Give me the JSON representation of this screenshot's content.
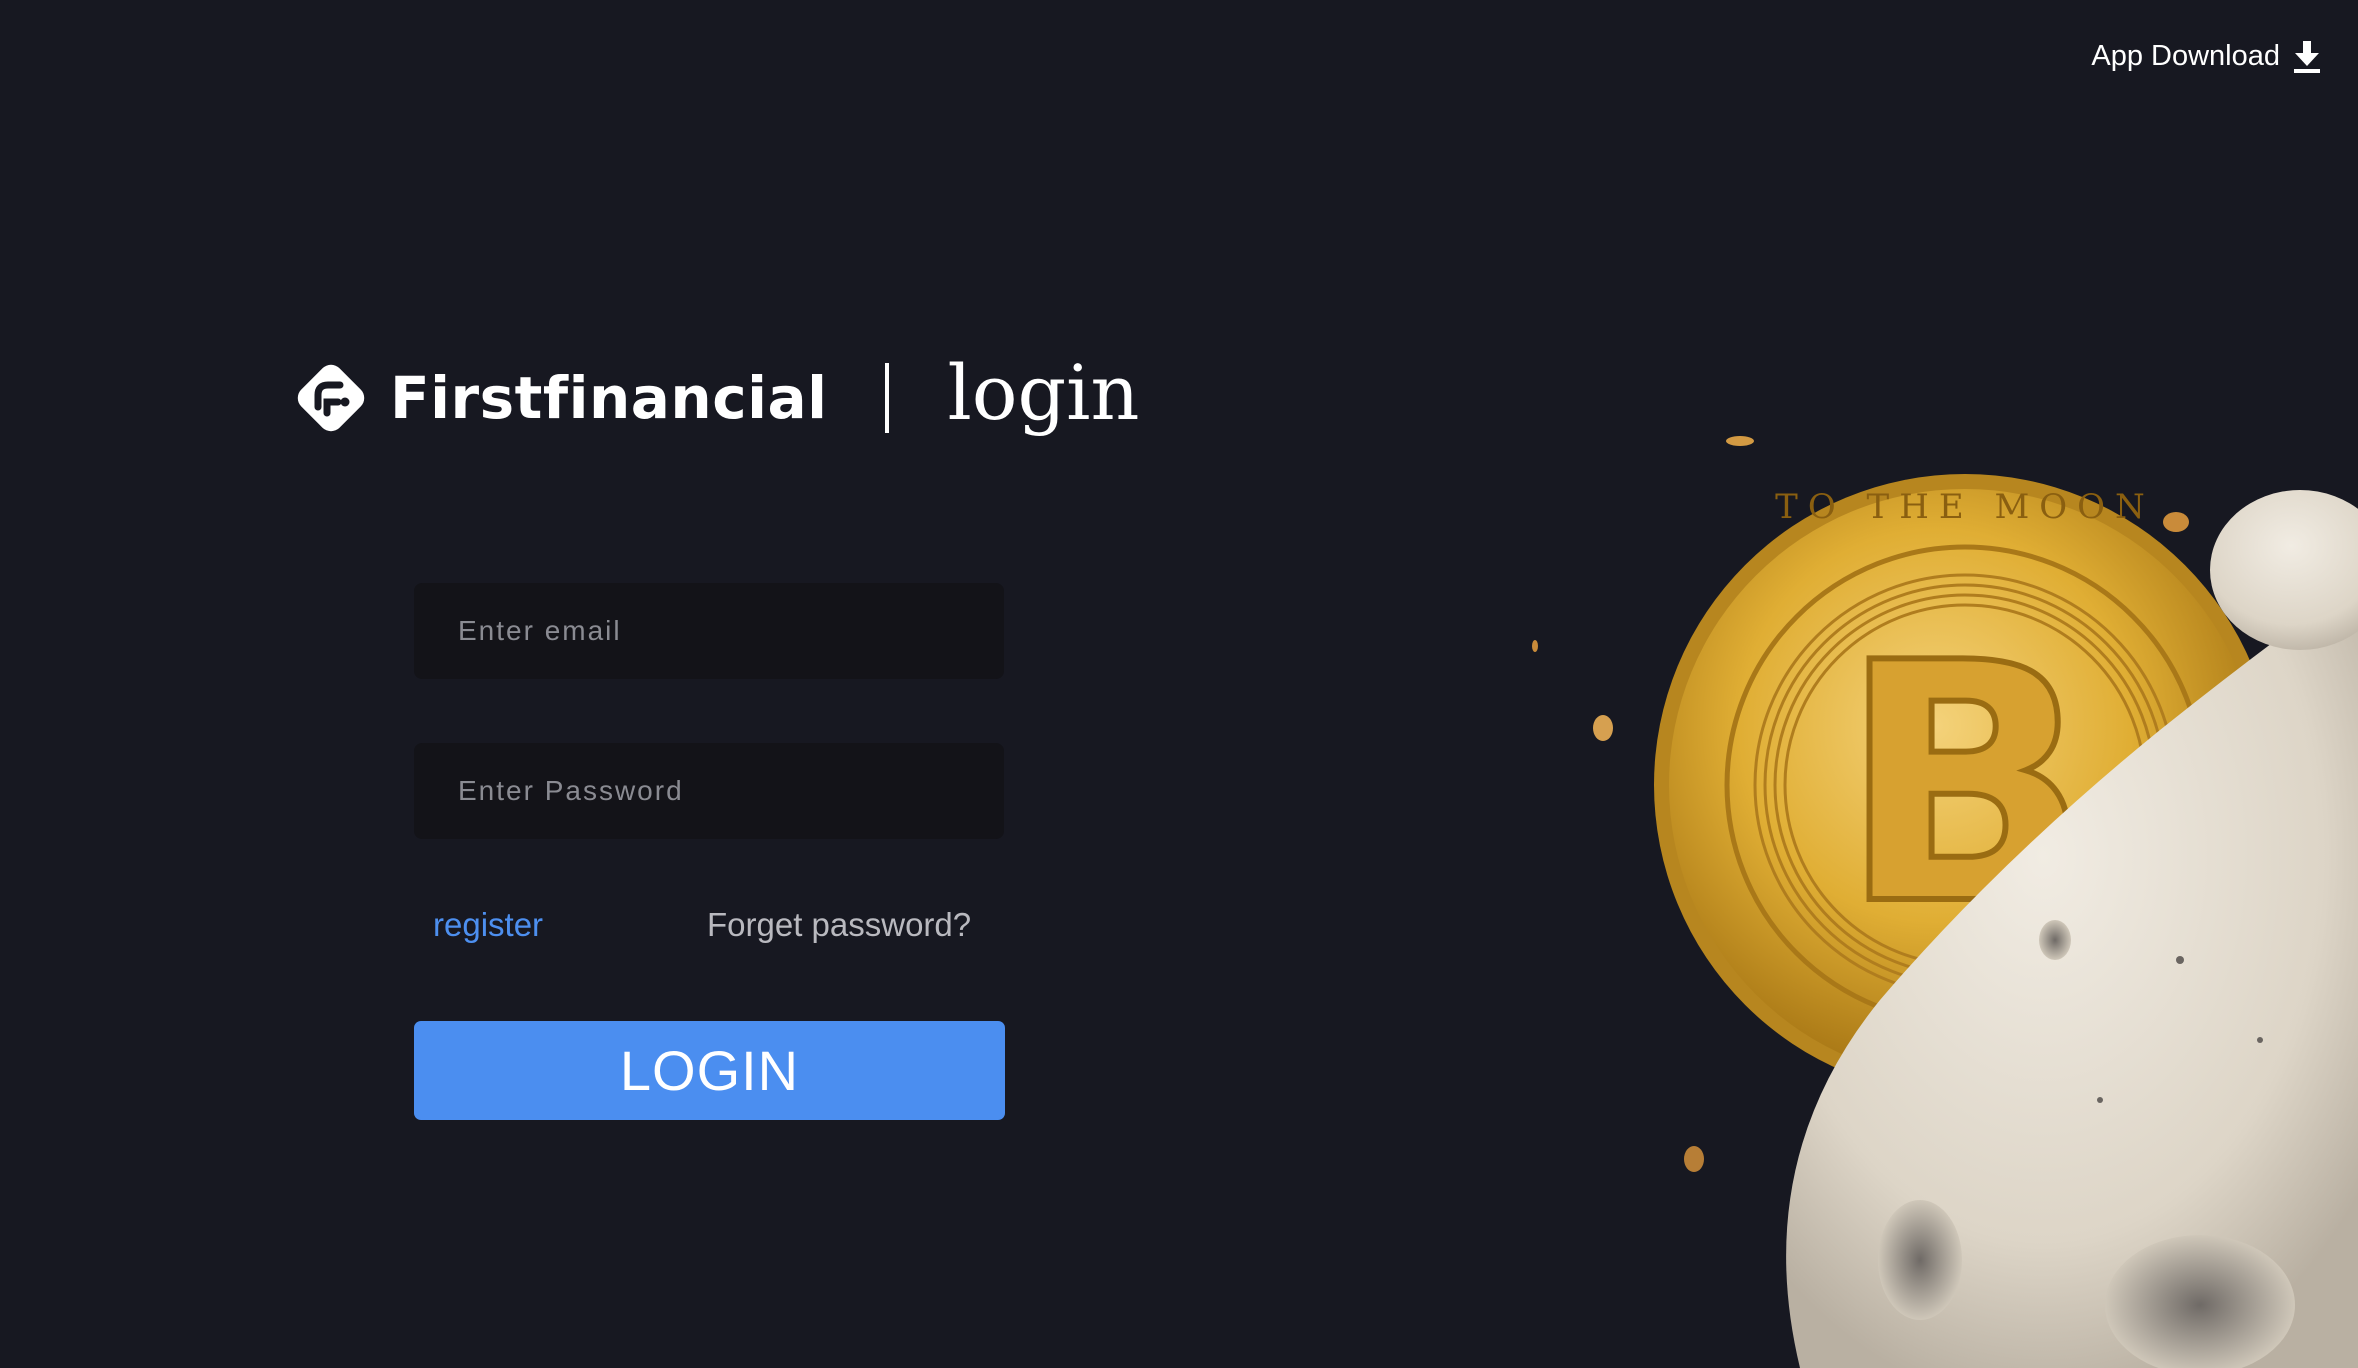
{
  "header": {
    "app_download_label": "App Download",
    "download_icon": "download-icon"
  },
  "brand": {
    "name": "Firstfinancial",
    "page_title": "login",
    "logo_icon": "firstfinancial-logo"
  },
  "form": {
    "email_placeholder": "Enter email",
    "password_placeholder": "Enter Password",
    "register_label": "register",
    "forget_password_label": "Forget password?",
    "login_button_label": "LOGIN"
  },
  "illustration": {
    "subject": "bitcoin-coin-and-moon",
    "coin_text": "TO THE MOON"
  },
  "colors": {
    "background": "#171821",
    "input_background": "#131318",
    "accent": "#4b8ef0",
    "link": "#4d8fef",
    "muted_text": "#b9b9bf",
    "coin_gold": "#e2b53c"
  }
}
